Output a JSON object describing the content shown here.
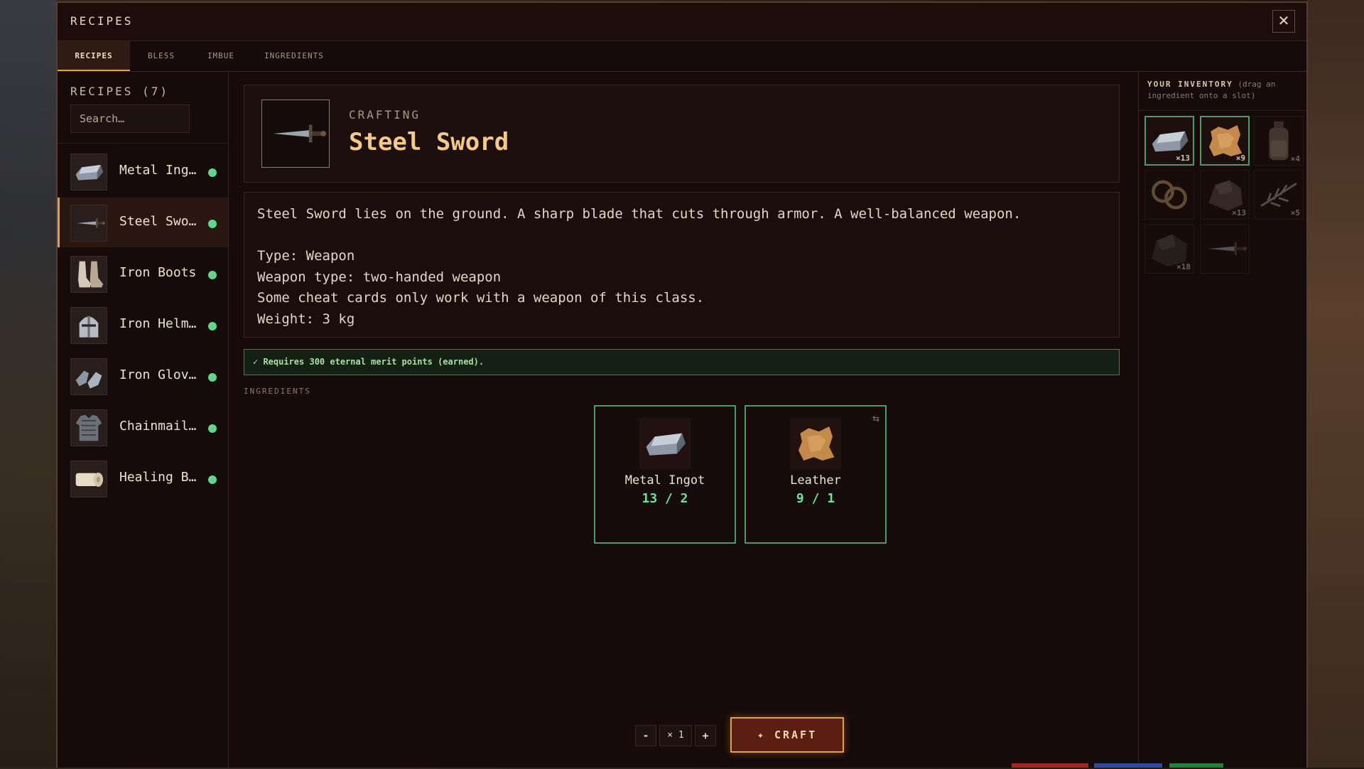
{
  "window": {
    "title": "RECIPES",
    "close_label": "✕"
  },
  "tabs": [
    {
      "label": "RECIPES",
      "active": true
    },
    {
      "label": "BLESS"
    },
    {
      "label": "IMBUE"
    },
    {
      "label": "INGREDIENTS"
    }
  ],
  "sidebar": {
    "title": "RECIPES (7)",
    "search_placeholder": "Search…",
    "recipes": [
      {
        "label": "Metal Ing…",
        "icon": "metal-ingot-icon",
        "available": true
      },
      {
        "label": "Steel Swo…",
        "icon": "steel-sword-icon",
        "available": true,
        "selected": true
      },
      {
        "label": "Iron Boots",
        "icon": "iron-boots-icon",
        "available": true
      },
      {
        "label": "Iron Helm…",
        "icon": "iron-helmet-icon",
        "available": true
      },
      {
        "label": "Iron Glov…",
        "icon": "iron-gloves-icon",
        "available": true
      },
      {
        "label": "Chainmail…",
        "icon": "chainmail-icon",
        "available": true
      },
      {
        "label": "Healing B…",
        "icon": "healing-bandage-icon",
        "available": true
      }
    ]
  },
  "item": {
    "category": "CRAFTING",
    "name": "Steel Sword",
    "description": [
      "Steel Sword lies on the ground. A sharp blade that cuts through armor. A well-balanced weapon.",
      "",
      "Type: Weapon",
      "Weapon type: two-handed weapon",
      "Some cheat cards only work with a weapon of this class.",
      "Weight: 3 kg"
    ],
    "requirement": "✓ Requires 300 eternal merit points (earned)."
  },
  "ingredients": {
    "title": "INGREDIENTS",
    "items": [
      {
        "name": "Metal Ingot",
        "qty": "13 / 2",
        "icon": "metal-ingot-icon"
      },
      {
        "name": "Leather",
        "qty": "9 / 1",
        "icon": "leather-icon",
        "swap_icon": "⇆"
      }
    ]
  },
  "craft": {
    "minus_label": "-",
    "quantity": "× 1",
    "plus_label": "+",
    "button_label": "✦ CRAFT"
  },
  "inventory": {
    "title": "YOUR INVENTORY",
    "subtitle": "(drag an ingredient onto a slot)",
    "slots": [
      {
        "icon": "metal-ingot-icon",
        "count": "×13",
        "highlighted": true
      },
      {
        "icon": "leather-icon",
        "count": "×9",
        "highlighted": true
      },
      {
        "icon": "potion-bottle-icon",
        "count": "×4",
        "dim": true
      },
      {
        "icon": "rope-icon",
        "count": "",
        "dim": true
      },
      {
        "icon": "ore-chunk-icon",
        "count": "×13",
        "dim": true
      },
      {
        "icon": "herb-icon",
        "count": "×5",
        "dim": true
      },
      {
        "icon": "coal-icon",
        "count": "×18",
        "dim": true
      },
      {
        "icon": "steel-sword-icon",
        "count": "",
        "dim": true
      }
    ]
  },
  "colors": {
    "accent": "#e0a050",
    "title_gold": "#f4c98a",
    "available_green": "#5fd88a",
    "panel_bg": "#160b0a"
  }
}
